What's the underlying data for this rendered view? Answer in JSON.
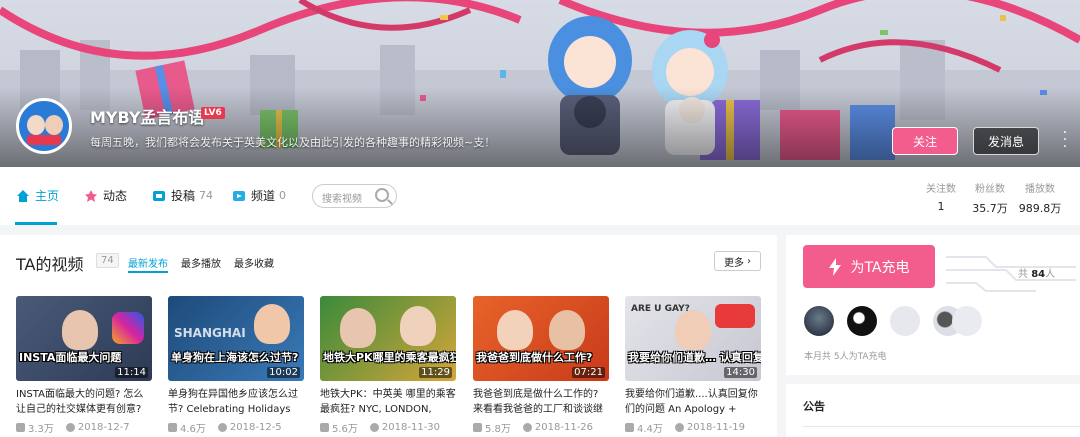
{
  "header": {
    "username": "MYBY孟言布语",
    "level_badge": "LV6",
    "signature": "每周五晚，我们都将会发布关于英美文化以及由此引发的各种趣事的精彩视频~支！",
    "follow_label": "关注",
    "message_label": "发消息",
    "more_icon": "more-vertical-icon",
    "accent_color": "#f25d8e"
  },
  "nav": {
    "items": [
      {
        "label": "主页",
        "icon": "home-icon",
        "count": ""
      },
      {
        "label": "动态",
        "icon": "dynamic-icon",
        "count": ""
      },
      {
        "label": "投稿",
        "icon": "upload-icon",
        "count": "74"
      },
      {
        "label": "频道",
        "icon": "channel-icon",
        "count": "0"
      }
    ],
    "search_placeholder": "搜索视频",
    "active_color": "#00a1d6",
    "stats": [
      {
        "label": "关注数",
        "value": "1"
      },
      {
        "label": "粉丝数",
        "value": "35.7万"
      },
      {
        "label": "播放数",
        "value": "989.8万"
      }
    ]
  },
  "videos_section": {
    "title": "TA的视频",
    "count": "74",
    "sort_options": [
      "最新发布",
      "最多播放",
      "最多收藏"
    ],
    "more_label": "更多",
    "videos": [
      {
        "thumb_caption": "INSTA面临最大问题",
        "duration": "11:14",
        "title": "INSTA面临最大的问题? 怎么让自己的社交媒体更有创意?",
        "plays": "3.3万",
        "date": "2018-12-7"
      },
      {
        "thumb_caption": "单身狗在上海该怎么过节?",
        "duration": "10:02",
        "title": "单身狗在异国他乡应该怎么过节? Celebrating Holidays",
        "plays": "4.6万",
        "date": "2018-12-5"
      },
      {
        "thumb_caption": "地铁大PK哪里的乘客最疯狂?",
        "duration": "11:29",
        "title": "地铁大PK：中英美 哪里的乘客最疯狂? NYC, LONDON,",
        "plays": "5.6万",
        "date": "2018-11-30"
      },
      {
        "thumb_caption": "我爸爸到底做什么工作?",
        "duration": "07:21",
        "title": "我爸爸到底是做什么工作的? 来看看我爸爸的工厂和谈谈继",
        "plays": "5.8万",
        "date": "2018-11-26"
      },
      {
        "thumb_caption": "我要给你们道歉… 认真回复你们的问题",
        "duration": "14:30",
        "title": "我要给你们道歉....认真回复你们的问题 An Apology +",
        "plays": "4.4万",
        "date": "2018-11-19"
      }
    ]
  },
  "charge": {
    "button_label": "为TA充电",
    "total_prefix": "共 ",
    "total_value": "84",
    "total_suffix": "人",
    "month_text": "本月共 5人为TA充电"
  },
  "notice": {
    "title": "公告"
  }
}
